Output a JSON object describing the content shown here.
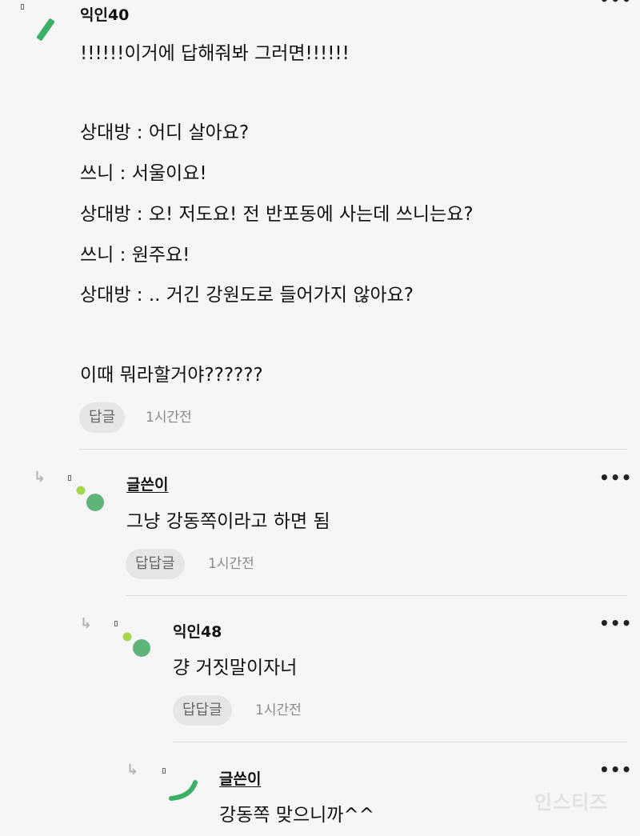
{
  "comments": [
    {
      "author": "익인40",
      "lines": [
        "!!!!!!이거에 답해줘봐 그러면!!!!!!",
        "",
        "상대방 : 어디 살아요?",
        "쓰니 : 서울이요!",
        "상대방 : 오! 저도요! 전 반포동에 사는데 쓰니는요?",
        "쓰니 : 원주요!",
        "상대방 : .. 거긴 강원도로 들어가지 않아요?",
        "",
        "이때 뭐라할거야??????"
      ],
      "reply_label": "답글",
      "time": "1시간전"
    },
    {
      "author": "글쓴이",
      "lines": [
        "그냥 강동쪽이라고 하면 됨"
      ],
      "reply_label": "답답글",
      "time": "1시간전"
    },
    {
      "author": "익인48",
      "lines": [
        "걍 거짓말이자너"
      ],
      "reply_label": "답답글",
      "time": "1시간전"
    },
    {
      "author": "글쓴이",
      "lines": [
        "강동쪽 맞으니까^^"
      ]
    }
  ],
  "more_label": "•••",
  "reply_arrow": "↳",
  "watermark": "인스티즈",
  "colors": {
    "avatar_green": "#5fb579",
    "avatar_lime": "#a6d650",
    "accent": "#3db067"
  }
}
